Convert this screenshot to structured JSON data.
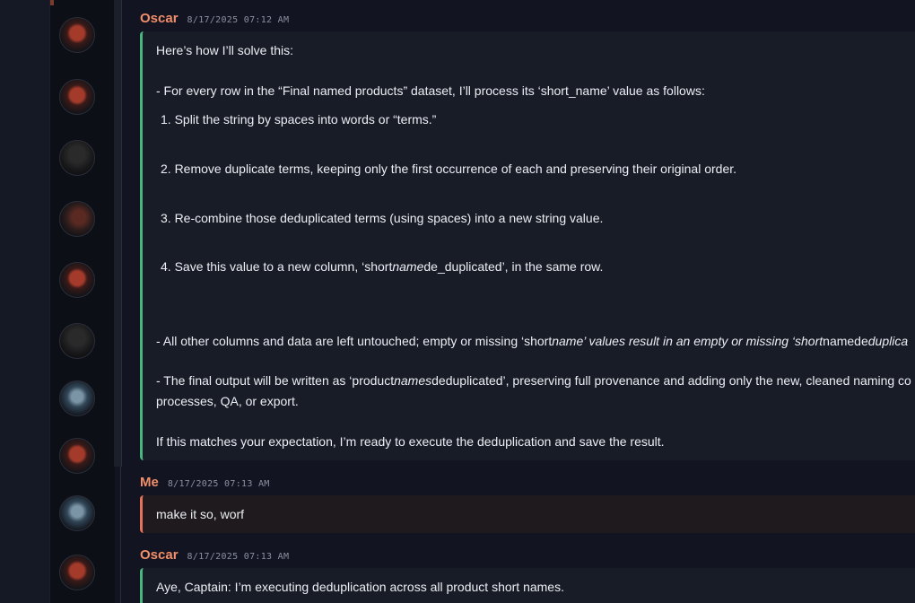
{
  "messages": [
    {
      "author": "Oscar",
      "timestamp": "8/17/2025 07:12 AM",
      "lines": {
        "intro": "Here’s how I’ll solve this:",
        "step_lead": "- For every row in the “Final named products” dataset, I’ll process its ‘short_name’ value as follows:",
        "s1": "1. Split the string by spaces into words or “terms.”",
        "s2": "2. Remove duplicate terms, keeping only the first occurrence of each and preserving their original order.",
        "s3": "3. Re-combine those deduplicated terms (using spaces) into a new string value.",
        "s4_a": "4. Save this value to a new column, ‘short",
        "s4_b": "name",
        "s4_c": "de_duplicated’, in the same row.",
        "other_a": "- All other columns and data are left untouched; empty or missing ‘short",
        "other_b": "name’ values result in an empty or missing ‘short",
        "other_c": "namede",
        "other_d": "duplica",
        "final_a": "- The final output will be written as ‘product",
        "final_b": "names",
        "final_c": "deduplicated’, preserving full provenance and adding only the new, cleaned naming co",
        "final_d": "processes, QA, or export.",
        "closing": "If this matches your expectation, I’m ready to execute the deduplication and save the result."
      }
    },
    {
      "author": "Me",
      "timestamp": "8/17/2025 07:13 AM",
      "text": "make it so, worf"
    },
    {
      "author": "Oscar",
      "timestamp": "8/17/2025 07:13 AM",
      "text": "Aye, Captain: I’m executing deduplication across all product short names."
    }
  ],
  "avatars": [
    "red-robot-avatar",
    "red-robot-avatar",
    "dark-robot-avatar",
    "ember-robot-avatar",
    "red-robot-avatar",
    "dark-robot-avatar",
    "blue-robot-avatar",
    "red-robot-avatar",
    "blue-robot-avatar",
    "red-robot-avatar"
  ],
  "colors": {
    "background": "#121521",
    "author": "#f28e69",
    "assistant_accent": "#4bb580",
    "user_accent": "#e5725a"
  }
}
